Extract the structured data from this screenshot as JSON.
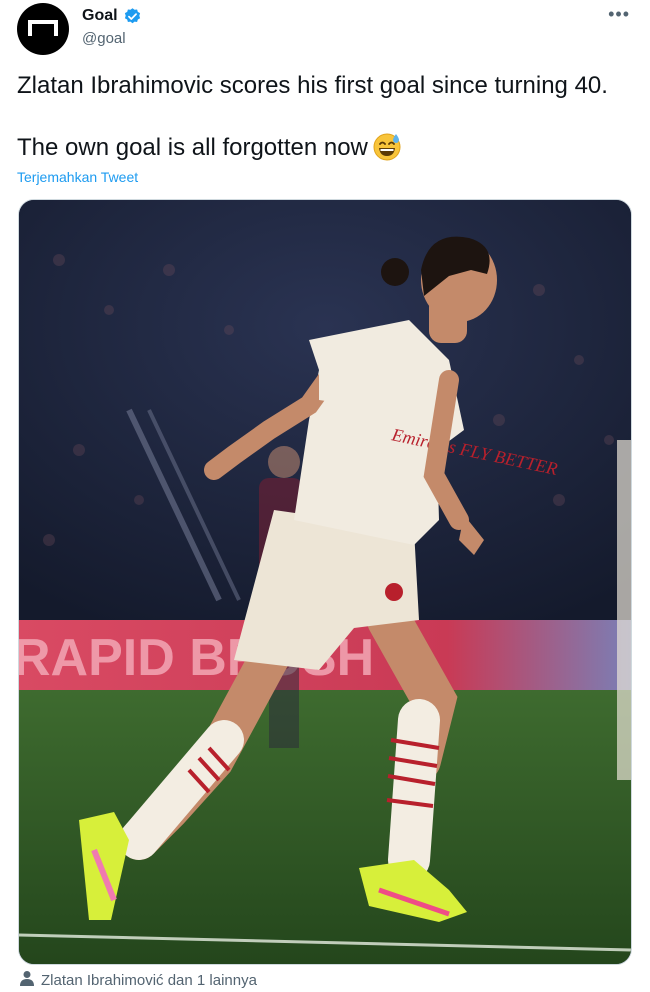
{
  "account": {
    "display_name": "Goal",
    "handle": "@goal",
    "verified": true,
    "avatar_icon": "goal-logo-icon"
  },
  "more_label": "•••",
  "tweet": {
    "line1": "Zlatan Ibrahimovic scores his first goal since turning 40.",
    "line2": "The own goal is all forgotten now",
    "emoji": "grinning-face-with-sweat-emoji"
  },
  "translate_label": "Terjemahkan Tweet",
  "media": {
    "banner_text": "RAPID BRUSH",
    "shirt_sponsor": "Emirates FLY BETTER"
  },
  "tagged_text": "Zlatan Ibrahimović dan 1 lainnya",
  "colors": {
    "accent": "#1d9bf0",
    "text": "#0f1419",
    "secondary_text": "#536471"
  }
}
